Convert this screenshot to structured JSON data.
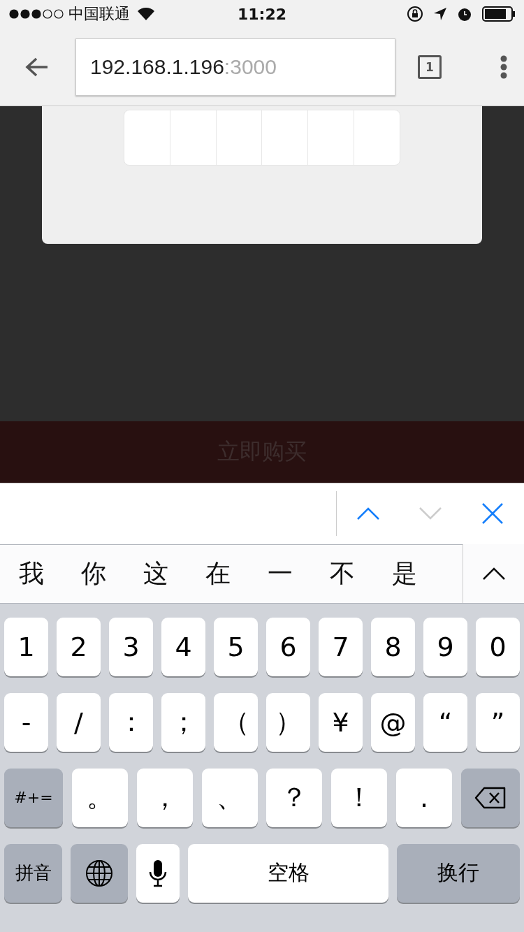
{
  "status_bar": {
    "carrier": "中国联通",
    "time": "11:22"
  },
  "browser": {
    "url_host": "192.168.1.196",
    "url_port": ":3000",
    "tab_count": "1"
  },
  "buy_button": {
    "label": "立即购买"
  },
  "form_toolbar": {
    "previous": {
      "disabled": false
    },
    "next": {
      "disabled": true
    }
  },
  "candidates": [
    "我",
    "你",
    "这",
    "在",
    "一",
    "不",
    "是"
  ],
  "keyboard": {
    "number_keys": [
      {
        "kind": "char",
        "label": "1"
      },
      {
        "kind": "char",
        "label": "2"
      },
      {
        "kind": "char",
        "label": "3"
      },
      {
        "kind": "char",
        "label": "4"
      },
      {
        "kind": "char",
        "label": "5"
      },
      {
        "kind": "char",
        "label": "6"
      },
      {
        "kind": "char",
        "label": "7"
      },
      {
        "kind": "char",
        "label": "8"
      },
      {
        "kind": "char",
        "label": "9"
      },
      {
        "kind": "char",
        "label": "0"
      }
    ],
    "symbol_keys": [
      {
        "kind": "char",
        "label": "-"
      },
      {
        "kind": "char",
        "label": "/"
      },
      {
        "kind": "char",
        "label": "："
      },
      {
        "kind": "char",
        "label": "；"
      },
      {
        "kind": "char",
        "label": "（"
      },
      {
        "kind": "char",
        "label": "）"
      },
      {
        "kind": "char",
        "label": "¥"
      },
      {
        "kind": "char",
        "label": "@"
      },
      {
        "kind": "char",
        "label": "“"
      },
      {
        "kind": "char",
        "label": "”"
      }
    ],
    "punctuation_keys": [
      {
        "kind": "special",
        "label": "#+="
      },
      {
        "kind": "wide",
        "label": "。"
      },
      {
        "kind": "wide",
        "label": "，"
      },
      {
        "kind": "wide",
        "label": "、"
      },
      {
        "kind": "wide",
        "label": "？"
      },
      {
        "kind": "wide",
        "label": "！"
      },
      {
        "kind": "wide",
        "label": "."
      },
      {
        "kind": "delete"
      }
    ],
    "bottom_keys": [
      {
        "kind": "special",
        "label": "拼音"
      },
      {
        "kind": "globe"
      },
      {
        "kind": "mic"
      },
      {
        "kind": "space",
        "label": "空格"
      },
      {
        "kind": "return",
        "label": "换行"
      }
    ]
  }
}
